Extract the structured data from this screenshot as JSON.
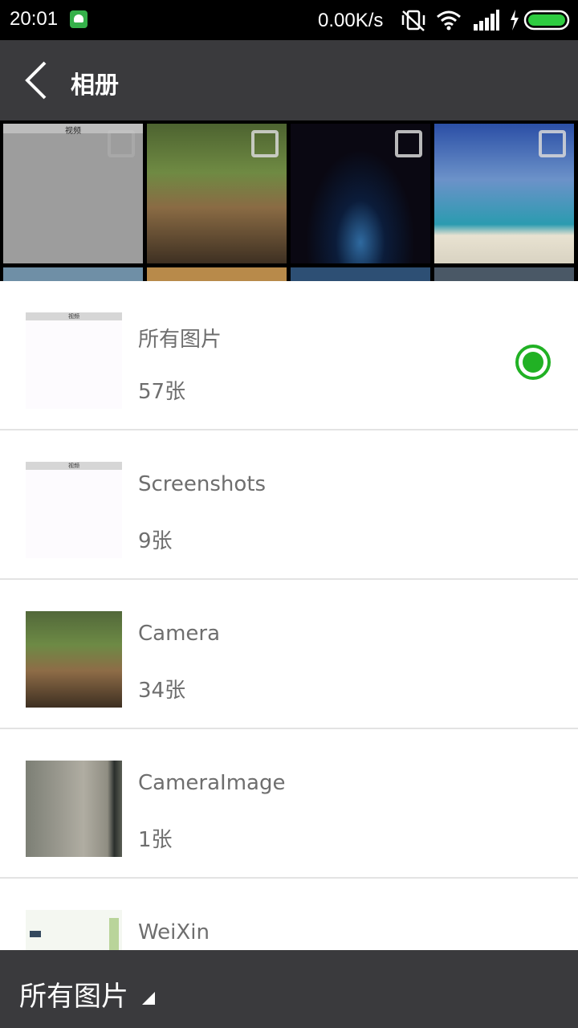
{
  "status_bar": {
    "time": "20:01",
    "net_speed": "0.00K/s",
    "icons": [
      "android-notification-icon",
      "vibrate-off-icon",
      "wifi-icon",
      "signal-icon",
      "battery-charging-icon"
    ],
    "battery_color": "#2ecc40"
  },
  "header": {
    "title": "相册",
    "back_icon": "chevron-left-icon"
  },
  "grid": {
    "first_cell_label": "视频"
  },
  "albums": [
    {
      "name": "所有图片",
      "count": "57张",
      "selected": true,
      "thumb_label": "视频"
    },
    {
      "name": "Screenshots",
      "count": "9张",
      "selected": false,
      "thumb_label": "视频"
    },
    {
      "name": "Camera",
      "count": "34张",
      "selected": false
    },
    {
      "name": "CameraImage",
      "count": "1张",
      "selected": false
    },
    {
      "name": "WeiXin",
      "count": "",
      "selected": false
    }
  ],
  "bottom_bar": {
    "label": "所有图片",
    "caret_icon": "dropdown-caret-icon"
  },
  "colors": {
    "bar_bg": "#3a3a3d",
    "accent_green": "#21b124",
    "text_gray": "#6e6e6e"
  }
}
